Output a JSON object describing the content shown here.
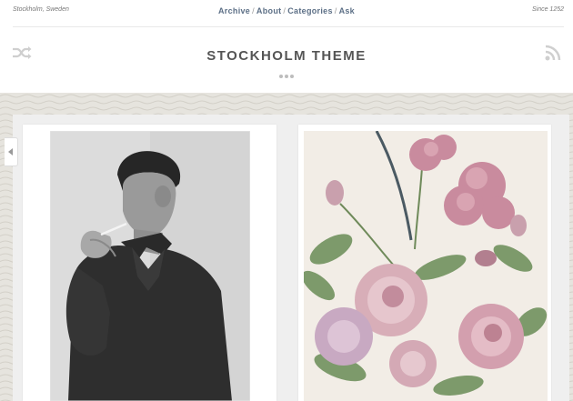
{
  "header": {
    "location": "Stockholm, Sweden",
    "since": "Since 1252",
    "nav": [
      "Archive",
      "About",
      "Categories",
      "Ask"
    ],
    "nav_separator": "/",
    "title": "STOCKHOLM THEME"
  },
  "icons": {
    "left": "shuffle-icon",
    "right": "rss-icon",
    "sidebar_toggle": "chevron-left-icon"
  },
  "posts": [
    {
      "type": "photo",
      "subject": "black-and-white portrait of a man smoking"
    },
    {
      "type": "photo",
      "subject": "botanical illustration of pink roses and carnations"
    }
  ],
  "colors": {
    "nav_link": "#5c6f86",
    "title": "#555555",
    "background_pattern": "#e6e4de"
  }
}
